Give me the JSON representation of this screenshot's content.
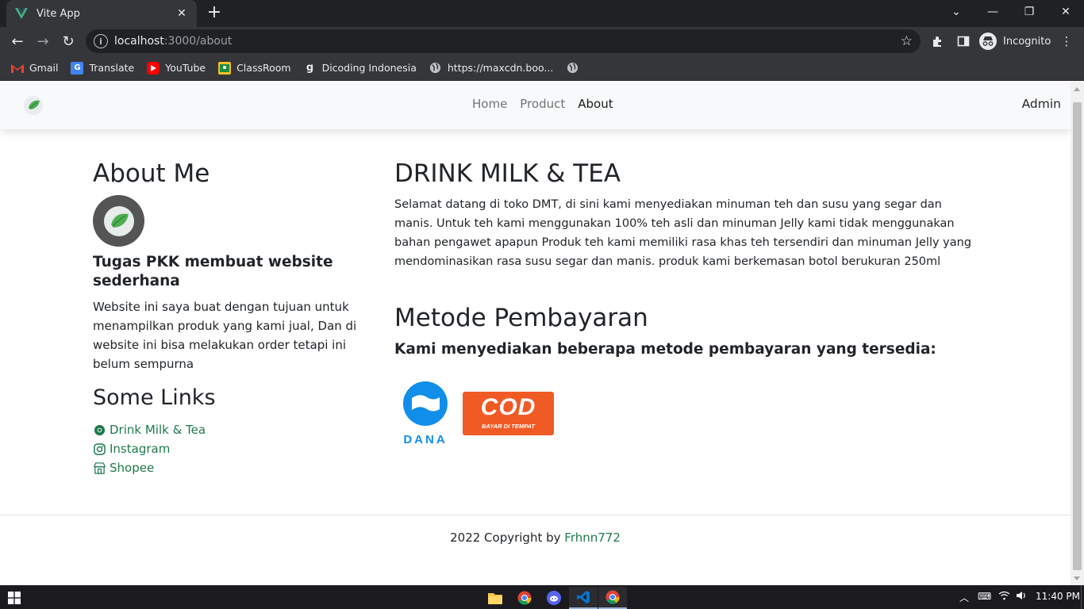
{
  "browser": {
    "tab_title": "Vite App",
    "url_host": "localhost",
    "url_path": ":3000/about",
    "incognito_label": "Incognito",
    "bookmarks": [
      {
        "label": "Gmail",
        "icon": "gmail-icon",
        "color": "#ea4335"
      },
      {
        "label": "Translate",
        "icon": "translate-icon",
        "color": "#4285f4"
      },
      {
        "label": "YouTube",
        "icon": "youtube-icon",
        "color": "#ff0000"
      },
      {
        "label": "ClassRoom",
        "icon": "classroom-icon",
        "color": "#f6bf26"
      },
      {
        "label": "Dicoding Indonesia",
        "icon": "dicoding-icon",
        "color": "#e8eaed"
      },
      {
        "label": "https://maxcdn.boo...",
        "icon": "globe-icon",
        "color": "#bdc1c6"
      },
      {
        "label": "",
        "icon": "globe-icon",
        "color": "#bdc1c6"
      }
    ]
  },
  "navbar": {
    "links": [
      "Home",
      "Product",
      "About"
    ],
    "active": "About",
    "admin": "Admin"
  },
  "about": {
    "title": "About Me",
    "subtitle": "Tugas PKK membuat website sederhana",
    "description": "Website ini saya buat dengan tujuan untuk menampilkan produk yang kami jual, Dan di website ini bisa melakukan order tetapi ini belum sempurna"
  },
  "links": {
    "title": "Some Links",
    "items": [
      {
        "label": "Drink Milk & Tea",
        "icon": "chrome-icon"
      },
      {
        "label": "Instagram",
        "icon": "instagram-icon"
      },
      {
        "label": "Shopee",
        "icon": "shop-icon"
      }
    ]
  },
  "drink": {
    "title": "DRINK MILK & TEA",
    "description": "Selamat datang di toko DMT, di sini kami menyediakan minuman teh dan susu yang segar dan manis. Untuk teh kami menggunakan 100% teh asli dan minuman Jelly kami tidak menggunakan bahan pengawet apapun Produk teh kami memiliki rasa khas teh tersendiri dan minuman Jelly yang mendominasikan rasa susu segar dan manis. produk kami berkemasan botol berukuran 250ml"
  },
  "payment": {
    "title": "Metode Pembayaran",
    "subtitle": "Kami menyediakan beberapa metode pembayaran yang tersedia:",
    "dana_label": "DANA",
    "cod_label": "COD",
    "cod_sub": "BAYAR DI TEMPAT"
  },
  "footer": {
    "text": "2022 Copyright by ",
    "author": "Frhnn772"
  },
  "taskbar": {
    "time": "11:40 PM"
  }
}
